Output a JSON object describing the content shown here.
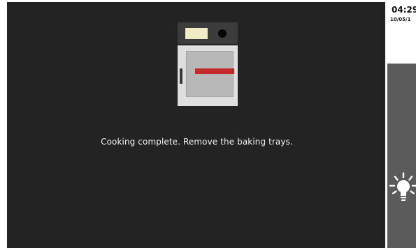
{
  "main": {
    "message": "Cooking complete. Remove the baking trays."
  },
  "sidebar": {
    "time": "04:29",
    "date": "10/05/1",
    "light_icon": "lightbulb-icon"
  },
  "colors": {
    "background": "#232323",
    "sidebar": "#5b5b5b",
    "tray": "#c42a2a",
    "oven_display": "#f1ebc5"
  }
}
